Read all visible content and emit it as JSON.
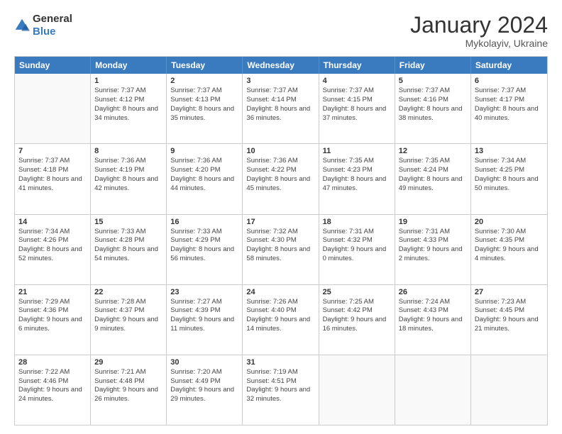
{
  "logo": {
    "general": "General",
    "blue": "Blue"
  },
  "header": {
    "title": "January 2024",
    "subtitle": "Mykolayiv, Ukraine"
  },
  "weekdays": [
    "Sunday",
    "Monday",
    "Tuesday",
    "Wednesday",
    "Thursday",
    "Friday",
    "Saturday"
  ],
  "rows": [
    [
      {
        "day": "",
        "sunrise": "",
        "sunset": "",
        "daylight": "",
        "empty": true
      },
      {
        "day": "1",
        "sunrise": "Sunrise: 7:37 AM",
        "sunset": "Sunset: 4:12 PM",
        "daylight": "Daylight: 8 hours and 34 minutes."
      },
      {
        "day": "2",
        "sunrise": "Sunrise: 7:37 AM",
        "sunset": "Sunset: 4:13 PM",
        "daylight": "Daylight: 8 hours and 35 minutes."
      },
      {
        "day": "3",
        "sunrise": "Sunrise: 7:37 AM",
        "sunset": "Sunset: 4:14 PM",
        "daylight": "Daylight: 8 hours and 36 minutes."
      },
      {
        "day": "4",
        "sunrise": "Sunrise: 7:37 AM",
        "sunset": "Sunset: 4:15 PM",
        "daylight": "Daylight: 8 hours and 37 minutes."
      },
      {
        "day": "5",
        "sunrise": "Sunrise: 7:37 AM",
        "sunset": "Sunset: 4:16 PM",
        "daylight": "Daylight: 8 hours and 38 minutes."
      },
      {
        "day": "6",
        "sunrise": "Sunrise: 7:37 AM",
        "sunset": "Sunset: 4:17 PM",
        "daylight": "Daylight: 8 hours and 40 minutes."
      }
    ],
    [
      {
        "day": "7",
        "sunrise": "Sunrise: 7:37 AM",
        "sunset": "Sunset: 4:18 PM",
        "daylight": "Daylight: 8 hours and 41 minutes."
      },
      {
        "day": "8",
        "sunrise": "Sunrise: 7:36 AM",
        "sunset": "Sunset: 4:19 PM",
        "daylight": "Daylight: 8 hours and 42 minutes."
      },
      {
        "day": "9",
        "sunrise": "Sunrise: 7:36 AM",
        "sunset": "Sunset: 4:20 PM",
        "daylight": "Daylight: 8 hours and 44 minutes."
      },
      {
        "day": "10",
        "sunrise": "Sunrise: 7:36 AM",
        "sunset": "Sunset: 4:22 PM",
        "daylight": "Daylight: 8 hours and 45 minutes."
      },
      {
        "day": "11",
        "sunrise": "Sunrise: 7:35 AM",
        "sunset": "Sunset: 4:23 PM",
        "daylight": "Daylight: 8 hours and 47 minutes."
      },
      {
        "day": "12",
        "sunrise": "Sunrise: 7:35 AM",
        "sunset": "Sunset: 4:24 PM",
        "daylight": "Daylight: 8 hours and 49 minutes."
      },
      {
        "day": "13",
        "sunrise": "Sunrise: 7:34 AM",
        "sunset": "Sunset: 4:25 PM",
        "daylight": "Daylight: 8 hours and 50 minutes."
      }
    ],
    [
      {
        "day": "14",
        "sunrise": "Sunrise: 7:34 AM",
        "sunset": "Sunset: 4:26 PM",
        "daylight": "Daylight: 8 hours and 52 minutes."
      },
      {
        "day": "15",
        "sunrise": "Sunrise: 7:33 AM",
        "sunset": "Sunset: 4:28 PM",
        "daylight": "Daylight: 8 hours and 54 minutes."
      },
      {
        "day": "16",
        "sunrise": "Sunrise: 7:33 AM",
        "sunset": "Sunset: 4:29 PM",
        "daylight": "Daylight: 8 hours and 56 minutes."
      },
      {
        "day": "17",
        "sunrise": "Sunrise: 7:32 AM",
        "sunset": "Sunset: 4:30 PM",
        "daylight": "Daylight: 8 hours and 58 minutes."
      },
      {
        "day": "18",
        "sunrise": "Sunrise: 7:31 AM",
        "sunset": "Sunset: 4:32 PM",
        "daylight": "Daylight: 9 hours and 0 minutes."
      },
      {
        "day": "19",
        "sunrise": "Sunrise: 7:31 AM",
        "sunset": "Sunset: 4:33 PM",
        "daylight": "Daylight: 9 hours and 2 minutes."
      },
      {
        "day": "20",
        "sunrise": "Sunrise: 7:30 AM",
        "sunset": "Sunset: 4:35 PM",
        "daylight": "Daylight: 9 hours and 4 minutes."
      }
    ],
    [
      {
        "day": "21",
        "sunrise": "Sunrise: 7:29 AM",
        "sunset": "Sunset: 4:36 PM",
        "daylight": "Daylight: 9 hours and 6 minutes."
      },
      {
        "day": "22",
        "sunrise": "Sunrise: 7:28 AM",
        "sunset": "Sunset: 4:37 PM",
        "daylight": "Daylight: 9 hours and 9 minutes."
      },
      {
        "day": "23",
        "sunrise": "Sunrise: 7:27 AM",
        "sunset": "Sunset: 4:39 PM",
        "daylight": "Daylight: 9 hours and 11 minutes."
      },
      {
        "day": "24",
        "sunrise": "Sunrise: 7:26 AM",
        "sunset": "Sunset: 4:40 PM",
        "daylight": "Daylight: 9 hours and 14 minutes."
      },
      {
        "day": "25",
        "sunrise": "Sunrise: 7:25 AM",
        "sunset": "Sunset: 4:42 PM",
        "daylight": "Daylight: 9 hours and 16 minutes."
      },
      {
        "day": "26",
        "sunrise": "Sunrise: 7:24 AM",
        "sunset": "Sunset: 4:43 PM",
        "daylight": "Daylight: 9 hours and 18 minutes."
      },
      {
        "day": "27",
        "sunrise": "Sunrise: 7:23 AM",
        "sunset": "Sunset: 4:45 PM",
        "daylight": "Daylight: 9 hours and 21 minutes."
      }
    ],
    [
      {
        "day": "28",
        "sunrise": "Sunrise: 7:22 AM",
        "sunset": "Sunset: 4:46 PM",
        "daylight": "Daylight: 9 hours and 24 minutes."
      },
      {
        "day": "29",
        "sunrise": "Sunrise: 7:21 AM",
        "sunset": "Sunset: 4:48 PM",
        "daylight": "Daylight: 9 hours and 26 minutes."
      },
      {
        "day": "30",
        "sunrise": "Sunrise: 7:20 AM",
        "sunset": "Sunset: 4:49 PM",
        "daylight": "Daylight: 9 hours and 29 minutes."
      },
      {
        "day": "31",
        "sunrise": "Sunrise: 7:19 AM",
        "sunset": "Sunset: 4:51 PM",
        "daylight": "Daylight: 9 hours and 32 minutes."
      },
      {
        "day": "",
        "sunrise": "",
        "sunset": "",
        "daylight": "",
        "empty": true
      },
      {
        "day": "",
        "sunrise": "",
        "sunset": "",
        "daylight": "",
        "empty": true
      },
      {
        "day": "",
        "sunrise": "",
        "sunset": "",
        "daylight": "",
        "empty": true
      }
    ]
  ]
}
